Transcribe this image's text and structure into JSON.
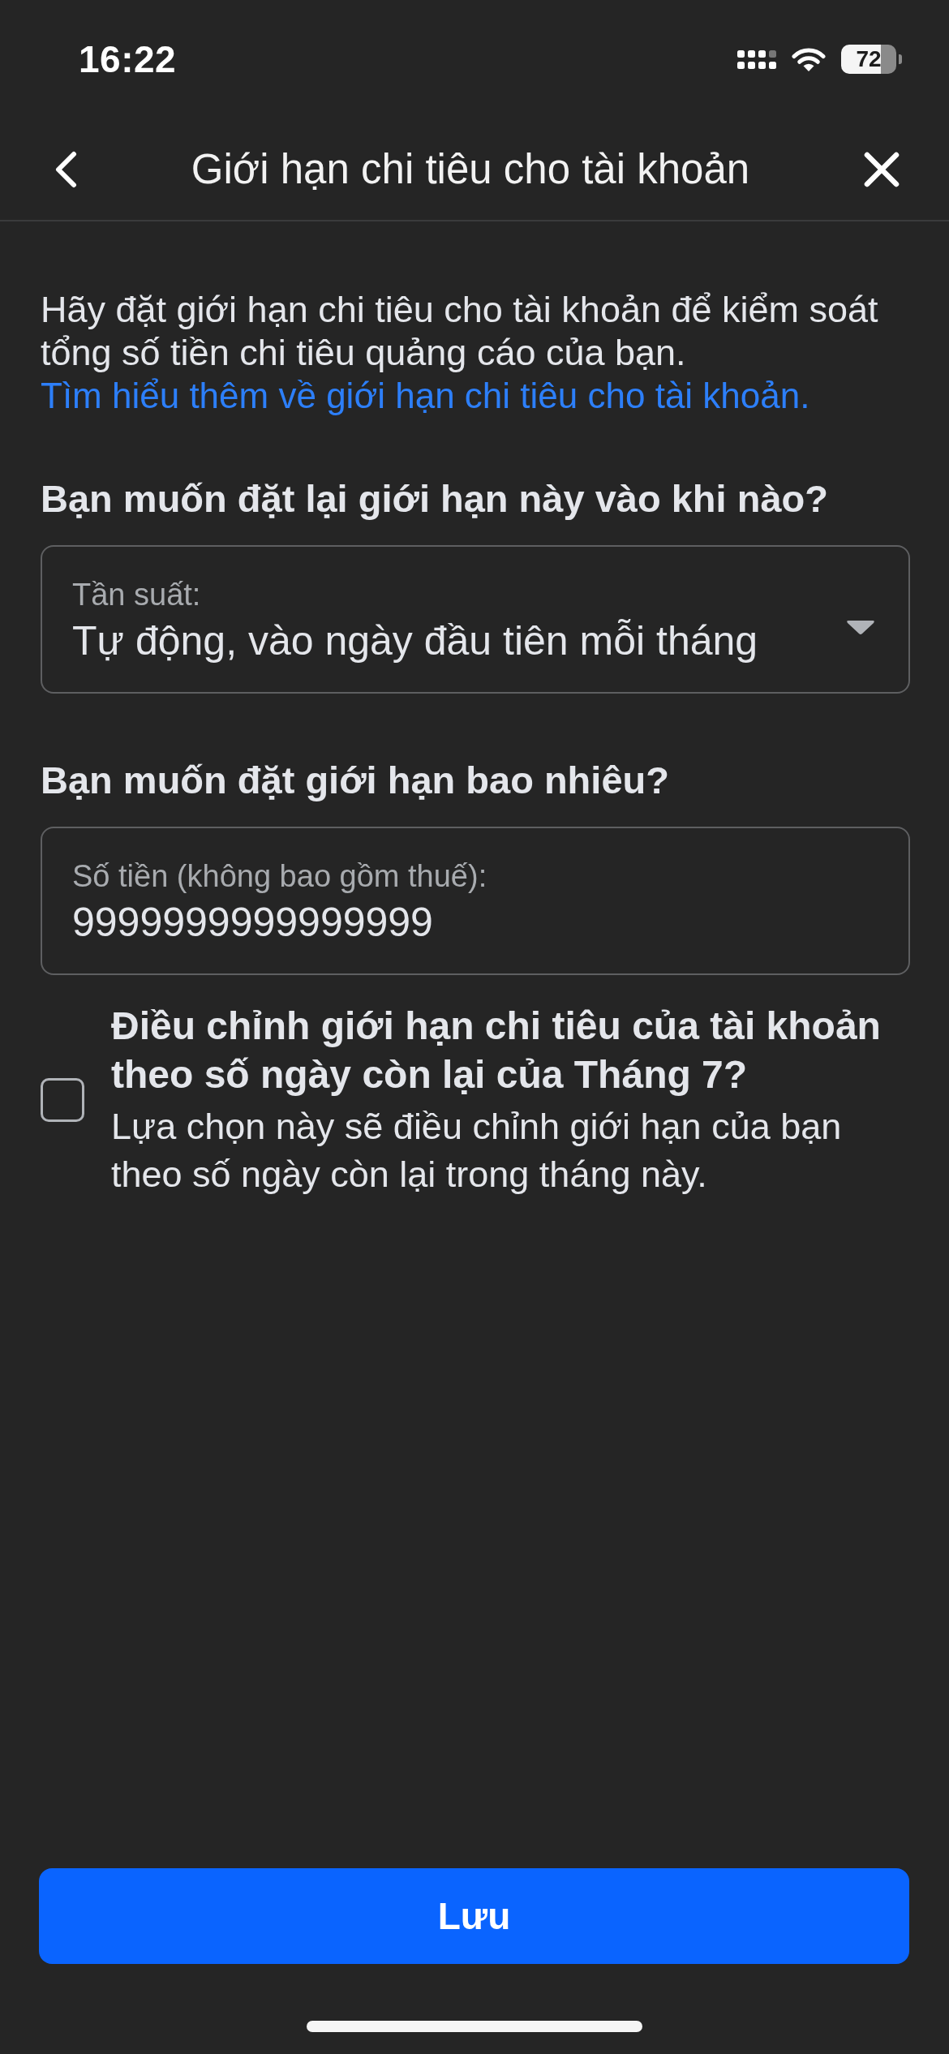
{
  "status_bar": {
    "time": "16:22",
    "battery": "72"
  },
  "header": {
    "title": "Giới hạn chi tiêu cho tài khoản"
  },
  "intro": {
    "text": "Hãy đặt giới hạn chi tiêu cho tài khoản để kiểm soát tổng số tiền chi tiêu quảng cáo của bạn.",
    "link": "Tìm hiểu thêm về giới hạn chi tiêu cho tài khoản."
  },
  "sections": [
    {
      "heading": "Bạn muốn đặt lại giới hạn này vào khi nào?",
      "field": {
        "kind": "dropdown",
        "label": "Tần suất:",
        "value": "Tự động, vào ngày đầu tiên mỗi tháng"
      }
    },
    {
      "heading": "Bạn muốn đặt giới hạn bao nhiêu?",
      "field": {
        "kind": "text",
        "label": "Số tiền (không bao gồm thuế):",
        "value": "9999999999999999"
      }
    }
  ],
  "option": {
    "checked": false,
    "title": "Điều chỉnh giới hạn chi tiêu của tài khoản theo số ngày còn lại của Tháng 7?",
    "description": "Lựa chọn này sẽ điều chỉnh giới hạn của bạn theo số ngày còn lại trong tháng này."
  },
  "save_button": {
    "label": "Lưu"
  }
}
